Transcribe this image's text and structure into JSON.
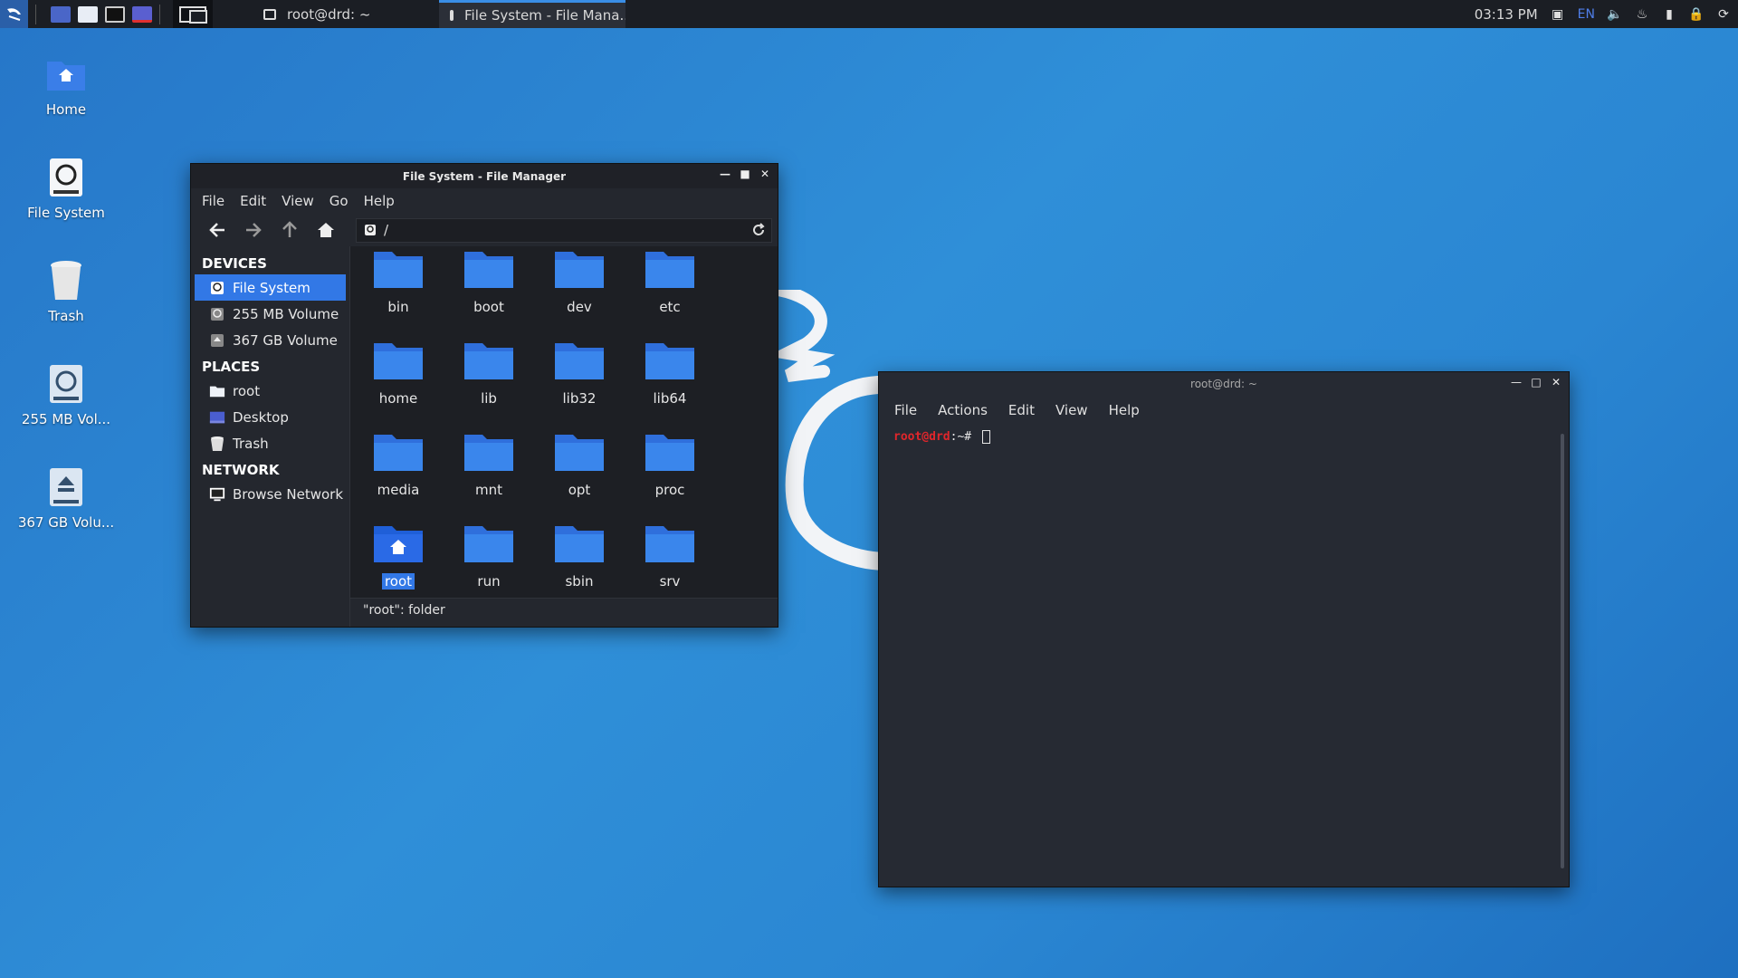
{
  "panel": {
    "tasks": [
      {
        "label": "root@drd: ~",
        "active": false
      },
      {
        "label": "File System - File Mana...",
        "active": true
      }
    ],
    "clock": "03:13 PM",
    "lang": "EN"
  },
  "desktop": {
    "icons": [
      {
        "label": "Home"
      },
      {
        "label": "File System"
      },
      {
        "label": "Trash"
      },
      {
        "label": "255 MB Vol..."
      },
      {
        "label": "367 GB Volu..."
      }
    ]
  },
  "file_manager": {
    "title": "File System - File Manager",
    "menu": [
      "File",
      "Edit",
      "View",
      "Go",
      "Help"
    ],
    "path": "/",
    "sidebar": {
      "devices_header": "DEVICES",
      "devices": [
        "File System",
        "255 MB Volume",
        "367 GB Volume"
      ],
      "places_header": "PLACES",
      "places": [
        "root",
        "Desktop",
        "Trash"
      ],
      "network_header": "NETWORK",
      "network": [
        "Browse Network"
      ]
    },
    "files": [
      "bin",
      "boot",
      "dev",
      "etc",
      "home",
      "lib",
      "lib32",
      "lib64",
      "media",
      "mnt",
      "opt",
      "proc",
      "root",
      "run",
      "sbin",
      "srv"
    ],
    "selected_file": "root",
    "status": "\"root\": folder"
  },
  "terminal": {
    "title": "root@drd: ~",
    "menu": [
      "File",
      "Actions",
      "Edit",
      "View",
      "Help"
    ],
    "prompt_user": "root@drd",
    "prompt_rest": ":~# "
  },
  "colors": {
    "accent": "#3278e6",
    "folder": "#3a7ee8",
    "prompt": "#e0262b"
  }
}
